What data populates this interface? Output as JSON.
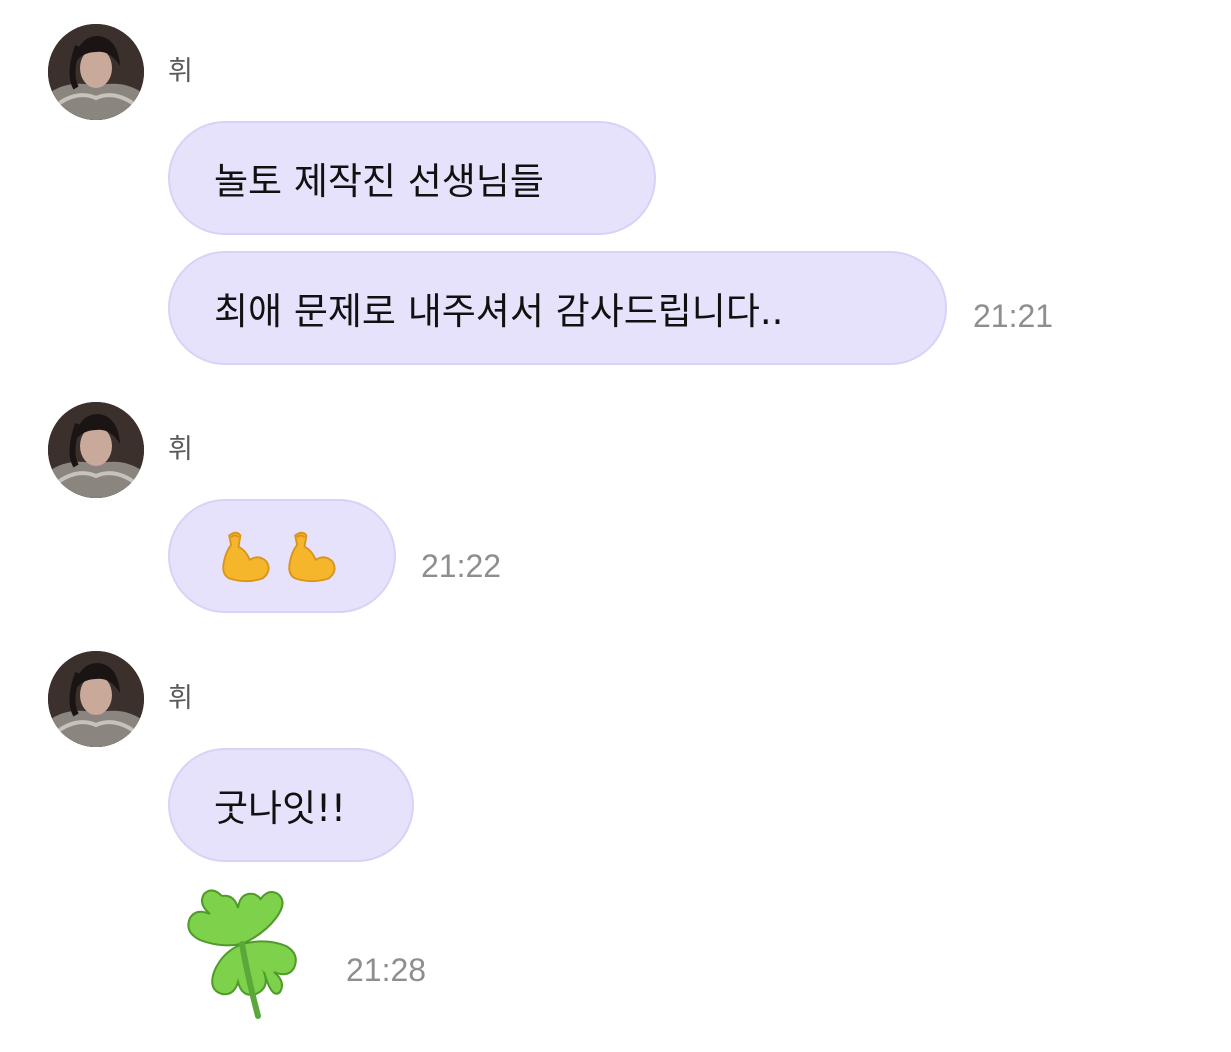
{
  "messages": [
    {
      "sender": "휘",
      "bubbles": [
        "놀토 제작진 선생님들",
        "최애 문제로 내주셔서 감사드립니다.."
      ],
      "time": "21:21"
    },
    {
      "sender": "휘",
      "emoji": [
        "flexed-biceps-icon",
        "flexed-biceps-icon"
      ],
      "time": "21:22"
    },
    {
      "sender": "휘",
      "bubbles": [
        "굿나잇!!"
      ],
      "sticker": "four-leaf-clover-icon",
      "time": "21:28"
    }
  ],
  "colors": {
    "bubble": "#e6e2fb",
    "bubble_border": "#d8d2f6",
    "time": "#8e8e8e",
    "sender": "#5a5a5a"
  }
}
